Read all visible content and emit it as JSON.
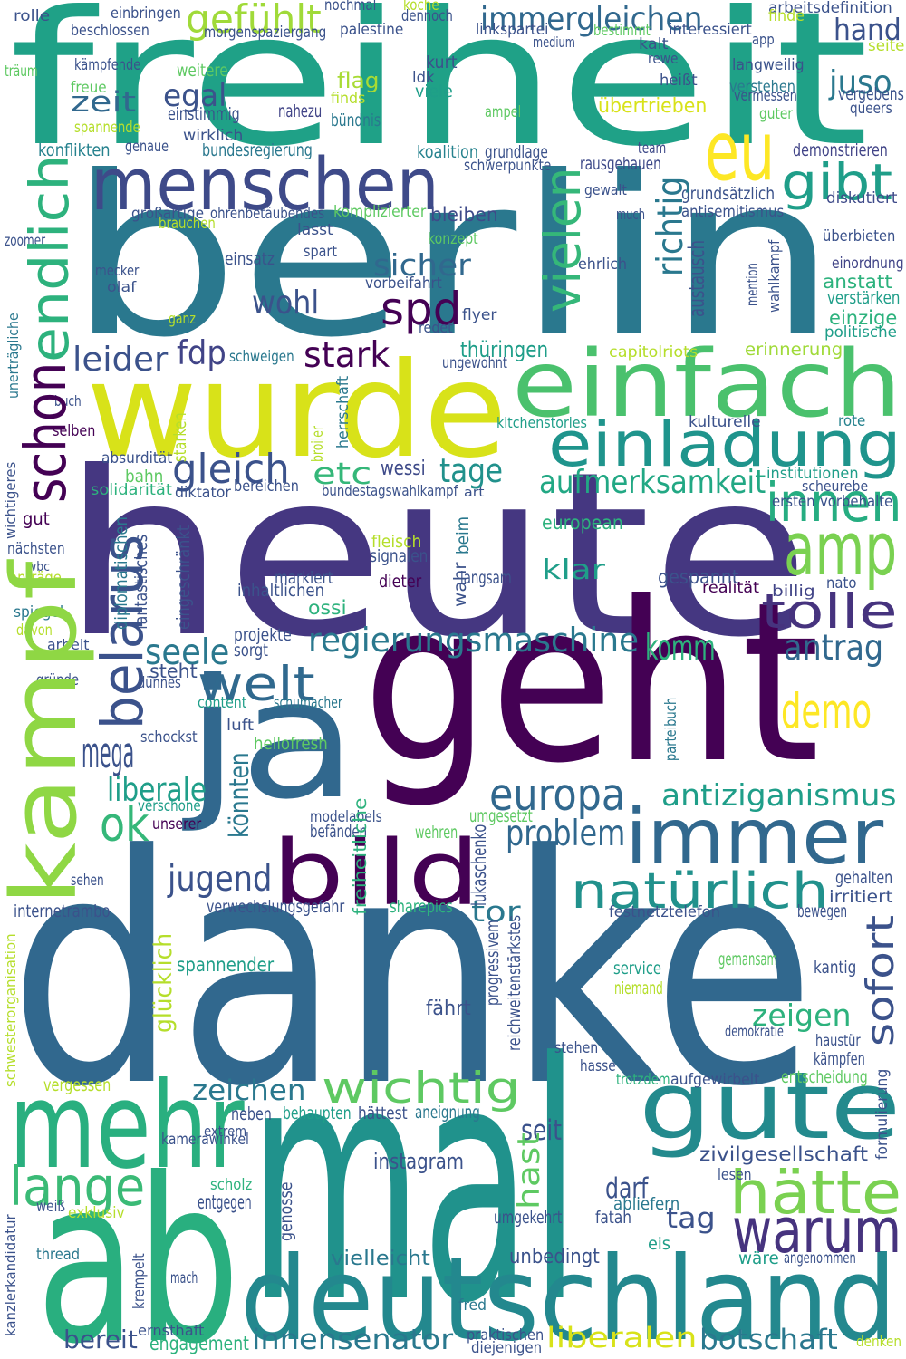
{
  "words": [
    {
      "text": "freiheit",
      "color": "#1fa187"
    },
    {
      "text": "berlin",
      "color": "#2a788e"
    },
    {
      "text": "wurde",
      "color": "#d8e219"
    },
    {
      "text": "einfach",
      "color": "#4ac16d"
    },
    {
      "text": "einladung",
      "color": "#1f948c"
    },
    {
      "text": "heute",
      "color": "#453781"
    },
    {
      "text": "geht",
      "color": "#440154"
    },
    {
      "text": "ja",
      "color": "#31688e"
    },
    {
      "text": "danke",
      "color": "#31688e"
    },
    {
      "text": "mal",
      "color": "#20928c"
    },
    {
      "text": "ab",
      "color": "#29af7f"
    },
    {
      "text": "deutschland",
      "color": "#23888e"
    },
    {
      "text": "gute",
      "color": "#238a8d"
    },
    {
      "text": "mehr",
      "color": "#29af7f"
    },
    {
      "text": "lange",
      "color": "#3aba76"
    },
    {
      "text": "hätte",
      "color": "#7ad151"
    },
    {
      "text": "warum",
      "color": "#46337e"
    },
    {
      "text": "amp",
      "color": "#7ad151"
    },
    {
      "text": "innen",
      "color": "#26ad81"
    },
    {
      "text": "tolle",
      "color": "#46337e"
    },
    {
      "text": "antrag",
      "color": "#31688e"
    },
    {
      "text": "demo",
      "color": "#fde725"
    },
    {
      "text": "immer",
      "color": "#31688e"
    },
    {
      "text": "bild",
      "color": "#440154"
    },
    {
      "text": "natürlich",
      "color": "#21918c"
    },
    {
      "text": "europa",
      "color": "#31688e"
    },
    {
      "text": "antiziganismus",
      "color": "#1f9e89"
    },
    {
      "text": "problem",
      "color": "#31688e"
    },
    {
      "text": "jugend",
      "color": "#3b528b"
    },
    {
      "text": "ok",
      "color": "#35b779"
    },
    {
      "text": "liberale",
      "color": "#1f9e89"
    },
    {
      "text": "mega",
      "color": "#3b528b"
    },
    {
      "text": "welt",
      "color": "#30698e"
    },
    {
      "text": "seele",
      "color": "#2a788e"
    },
    {
      "text": "regierungsmaschine",
      "color": "#2a788e"
    },
    {
      "text": "komm",
      "color": "#2db27d"
    },
    {
      "text": "gleich",
      "color": "#3b528b"
    },
    {
      "text": "etc",
      "color": "#35b779"
    },
    {
      "text": "wessi",
      "color": "#3e4a89"
    },
    {
      "text": "tage",
      "color": "#21918c"
    },
    {
      "text": "aufmerksamkeit",
      "color": "#22a884"
    },
    {
      "text": "stark",
      "color": "#440154"
    },
    {
      "text": "leider",
      "color": "#3b528b"
    },
    {
      "text": "fdp",
      "color": "#414487"
    },
    {
      "text": "thüringen",
      "color": "#1f9e89"
    },
    {
      "text": "spd",
      "color": "#440154"
    },
    {
      "text": "wohl",
      "color": "#3b528b"
    },
    {
      "text": "sicher",
      "color": "#31688e"
    },
    {
      "text": "menschen",
      "color": "#3e4a89"
    },
    {
      "text": "eu",
      "color": "#fde725"
    },
    {
      "text": "gibt",
      "color": "#1f9e89"
    },
    {
      "text": "immergleichen",
      "color": "#31688e"
    },
    {
      "text": "gefühlt",
      "color": "#a0da39"
    },
    {
      "text": "egal",
      "color": "#3b528b"
    },
    {
      "text": "zeit",
      "color": "#31688e"
    },
    {
      "text": "hand",
      "color": "#3b528b"
    },
    {
      "text": "juso",
      "color": "#2a788e"
    },
    {
      "text": "übertrieben",
      "color": "#d8e219"
    },
    {
      "text": "flag",
      "color": "#a8db34"
    },
    {
      "text": "viele",
      "color": "#1f9e89"
    },
    {
      "text": "kurt",
      "color": "#3b528b"
    },
    {
      "text": "ldk",
      "color": "#3b528b"
    },
    {
      "text": "nahezu",
      "color": "#414487"
    },
    {
      "text": "bündnis",
      "color": "#2a788e"
    },
    {
      "text": "konflikten",
      "color": "#26828e"
    },
    {
      "text": "bundesregierung",
      "color": "#2a788e"
    },
    {
      "text": "team",
      "color": "#3e4a89"
    },
    {
      "text": "demonstrieren",
      "color": "#414487"
    },
    {
      "text": "grundlage",
      "color": "#3b528b"
    },
    {
      "text": "koalition",
      "color": "#26828e"
    },
    {
      "text": "rausgehauen",
      "color": "#3e4a89"
    },
    {
      "text": "schwerpunkte",
      "color": "#3b528b"
    },
    {
      "text": "grundsätzlich",
      "color": "#3b528b"
    },
    {
      "text": "antisemitismus",
      "color": "#3b528b"
    },
    {
      "text": "bleiben",
      "color": "#3e4a89"
    },
    {
      "text": "komplizierter",
      "color": "#5ec962"
    },
    {
      "text": "ohrenbetäubendes",
      "color": "#3b528b"
    },
    {
      "text": "diskutiert",
      "color": "#3e4a89"
    },
    {
      "text": "überbieten",
      "color": "#3b528b"
    },
    {
      "text": "einordnung",
      "color": "#414487"
    },
    {
      "text": "anstatt",
      "color": "#2db27d"
    },
    {
      "text": "verstärken",
      "color": "#1f9e89"
    },
    {
      "text": "einzige",
      "color": "#2db27d"
    },
    {
      "text": "politische",
      "color": "#1f9e89"
    },
    {
      "text": "erinnerung",
      "color": "#a0da39"
    },
    {
      "text": "capitolriots",
      "color": "#b5de2b"
    },
    {
      "text": "ungewohnt",
      "color": "#3b528b"
    },
    {
      "text": "kitchenstories",
      "color": "#1f9e89"
    },
    {
      "text": "kulturelle",
      "color": "#3b528b"
    },
    {
      "text": "rote",
      "color": "#26828e"
    },
    {
      "text": "institutionen",
      "color": "#1f9e89"
    },
    {
      "text": "scheurebe",
      "color": "#3b528b"
    },
    {
      "text": "ersten",
      "color": "#3b528b"
    },
    {
      "text": "vorbehalte",
      "color": "#3b528b"
    },
    {
      "text": "nato",
      "color": "#3b528b"
    },
    {
      "text": "billig",
      "color": "#414487"
    },
    {
      "text": "realität",
      "color": "#440154"
    },
    {
      "text": "gespannt",
      "color": "#3b528b"
    },
    {
      "text": "klar",
      "color": "#1f9e89"
    },
    {
      "text": "european",
      "color": "#2db27d"
    },
    {
      "text": "signalen",
      "color": "#3b528b"
    },
    {
      "text": "fleisch",
      "color": "#b5de2b"
    },
    {
      "text": "dieter",
      "color": "#440154"
    },
    {
      "text": "langsam",
      "color": "#3b528b"
    },
    {
      "text": "inhaltlichen",
      "color": "#3b528b"
    },
    {
      "text": "markiert",
      "color": "#3b528b"
    },
    {
      "text": "ossi",
      "color": "#2db27d"
    },
    {
      "text": "projekte",
      "color": "#3b528b"
    },
    {
      "text": "sorgt",
      "color": "#3b528b"
    },
    {
      "text": "steht",
      "color": "#3b528b"
    },
    {
      "text": "dünnes",
      "color": "#3b528b"
    },
    {
      "text": "content",
      "color": "#1f9e89"
    },
    {
      "text": "schumacher",
      "color": "#2a788e"
    },
    {
      "text": "luft",
      "color": "#3b528b"
    },
    {
      "text": "schockst",
      "color": "#3b528b"
    },
    {
      "text": "hellofresh",
      "color": "#5ec962"
    },
    {
      "text": "verschone",
      "color": "#1f9e89"
    },
    {
      "text": "unserer",
      "color": "#440154"
    },
    {
      "text": "modelabels",
      "color": "#3b528b"
    },
    {
      "text": "befänden",
      "color": "#3b528b"
    },
    {
      "text": "umgesetzt",
      "color": "#5ec962"
    },
    {
      "text": "wehren",
      "color": "#5ec962"
    },
    {
      "text": "sharepics",
      "color": "#2db27d"
    },
    {
      "text": "tor",
      "color": "#2a788e"
    },
    {
      "text": "verwechslungsgefahr",
      "color": "#3b528b"
    },
    {
      "text": "internetrambo",
      "color": "#3b528b"
    },
    {
      "text": "sehen",
      "color": "#3b528b"
    },
    {
      "text": "festnetztelefon",
      "color": "#3b528b"
    },
    {
      "text": "gehalten",
      "color": "#3b528b"
    },
    {
      "text": "irritiert",
      "color": "#3b528b"
    },
    {
      "text": "bewegen",
      "color": "#3b528b"
    },
    {
      "text": "spannender",
      "color": "#1f9e89"
    },
    {
      "text": "gemansam",
      "color": "#5ec962"
    },
    {
      "text": "service",
      "color": "#1f9e89"
    },
    {
      "text": "kantig",
      "color": "#3b528b"
    },
    {
      "text": "niemand",
      "color": "#b5de2b"
    },
    {
      "text": "fährt",
      "color": "#3b528b"
    },
    {
      "text": "zeigen",
      "color": "#2db27d"
    },
    {
      "text": "demokratie",
      "color": "#3b528b"
    },
    {
      "text": "haustür",
      "color": "#3b528b"
    },
    {
      "text": "kämpfen",
      "color": "#3b528b"
    },
    {
      "text": "stehen",
      "color": "#3b528b"
    },
    {
      "text": "hasse",
      "color": "#3b528b"
    },
    {
      "text": "trotzdem",
      "color": "#2db27d"
    },
    {
      "text": "aufgewirbelt",
      "color": "#3b528b"
    },
    {
      "text": "entscheidung",
      "color": "#5ec962"
    },
    {
      "text": "wichtig",
      "color": "#5ec962"
    },
    {
      "text": "zeichen",
      "color": "#2a788e"
    },
    {
      "text": "neben",
      "color": "#3b528b"
    },
    {
      "text": "behaupten",
      "color": "#1f9e89"
    },
    {
      "text": "hättest",
      "color": "#3b528b"
    },
    {
      "text": "aneignung",
      "color": "#2a788e"
    },
    {
      "text": "seit",
      "color": "#3b528b"
    },
    {
      "text": "zivilgesellschaft",
      "color": "#3b528b"
    },
    {
      "text": "instagram",
      "color": "#3b528b"
    },
    {
      "text": "darf",
      "color": "#3b528b"
    },
    {
      "text": "lesen",
      "color": "#3b528b"
    },
    {
      "text": "abliefern",
      "color": "#2a788e"
    },
    {
      "text": "tag",
      "color": "#3b528b"
    },
    {
      "text": "fatah",
      "color": "#3b528b"
    },
    {
      "text": "umgekehrt",
      "color": "#3b528b"
    },
    {
      "text": "vielleicht",
      "color": "#2a788e"
    },
    {
      "text": "unbedingt",
      "color": "#3b528b"
    },
    {
      "text": "eis",
      "color": "#1f9e89"
    },
    {
      "text": "wäre",
      "color": "#1f9e89"
    },
    {
      "text": "angenommen",
      "color": "#3b528b"
    },
    {
      "text": "entgegen",
      "color": "#3b528b"
    },
    {
      "text": "scholz",
      "color": "#2db27d"
    },
    {
      "text": "kamerawinkel",
      "color": "#3b528b"
    },
    {
      "text": "extrem",
      "color": "#3b528b"
    },
    {
      "text": "vergessen",
      "color": "#b5de2b"
    },
    {
      "text": "exklusiv",
      "color": "#b5de2b"
    },
    {
      "text": "weiß",
      "color": "#3b528b"
    },
    {
      "text": "thread",
      "color": "#2a788e"
    },
    {
      "text": "mach",
      "color": "#3b528b"
    },
    {
      "text": "bereit",
      "color": "#3b528b"
    },
    {
      "text": "ernsthaft",
      "color": "#3b528b"
    },
    {
      "text": "engagement",
      "color": "#2db27d"
    },
    {
      "text": "innensenator",
      "color": "#2a788e"
    },
    {
      "text": "praktischen",
      "color": "#3b528b"
    },
    {
      "text": "diejenigen",
      "color": "#3b528b"
    },
    {
      "text": "liberalen",
      "color": "#d8e219"
    },
    {
      "text": "botschaft",
      "color": "#2a788e"
    },
    {
      "text": "denken",
      "color": "#b5de2b"
    },
    {
      "text": "fred",
      "color": "#2a788e"
    },
    {
      "text": "arbeit",
      "color": "#3b528b"
    },
    {
      "text": "gründe",
      "color": "#3b528b"
    },
    {
      "text": "bahn",
      "color": "#5ec962"
    },
    {
      "text": "solidarität",
      "color": "#2db27d"
    },
    {
      "text": "absurdität",
      "color": "#3b528b"
    },
    {
      "text": "diktator",
      "color": "#3b528b"
    },
    {
      "text": "bereichen",
      "color": "#3b528b"
    },
    {
      "text": "bundestagswahlkampf",
      "color": "#3b528b"
    },
    {
      "text": "art",
      "color": "#3b528b"
    },
    {
      "text": "gut",
      "color": "#440154"
    },
    {
      "text": "nächsten",
      "color": "#3b528b"
    },
    {
      "text": "wbc",
      "color": "#3b528b"
    },
    {
      "text": "anträge",
      "color": "#b5de2b"
    },
    {
      "text": "spiegel",
      "color": "#2a788e"
    },
    {
      "text": "davon",
      "color": "#b5de2b"
    },
    {
      "text": "buch",
      "color": "#3b528b"
    },
    {
      "text": "selben",
      "color": "#440154"
    },
    {
      "text": "mecker",
      "color": "#3b528b"
    },
    {
      "text": "olaf",
      "color": "#3b528b"
    },
    {
      "text": "einsatz",
      "color": "#3b528b"
    },
    {
      "text": "lasst",
      "color": "#3b528b"
    },
    {
      "text": "spart",
      "color": "#3b528b"
    },
    {
      "text": "großartige",
      "color": "#3b528b"
    },
    {
      "text": "brauchen",
      "color": "#b5de2b"
    },
    {
      "text": "zoomer",
      "color": "#3b528b"
    },
    {
      "text": "ganz",
      "color": "#b5de2b"
    },
    {
      "text": "schweigen",
      "color": "#2a788e"
    },
    {
      "text": "redet",
      "color": "#3b528b"
    },
    {
      "text": "flyer",
      "color": "#3b528b"
    },
    {
      "text": "vorbeifahrt",
      "color": "#3b528b"
    },
    {
      "text": "konzept",
      "color": "#5ec962"
    },
    {
      "text": "gewalt",
      "color": "#3b528b"
    },
    {
      "text": "much",
      "color": "#3b528b"
    },
    {
      "text": "ehrlich",
      "color": "#3b528b"
    },
    {
      "text": "rolle",
      "color": "#3b528b"
    },
    {
      "text": "beschlossen",
      "color": "#3b528b"
    },
    {
      "text": "kämpfende",
      "color": "#3b528b"
    },
    {
      "text": "freue",
      "color": "#5ec962"
    },
    {
      "text": "einstimmig",
      "color": "#3b528b"
    },
    {
      "text": "wirklich",
      "color": "#3b528b"
    },
    {
      "text": "spannende",
      "color": "#b5de2b"
    },
    {
      "text": "genaue",
      "color": "#3b528b"
    },
    {
      "text": "weitere",
      "color": "#5ec962"
    },
    {
      "text": "morgenspaziergang",
      "color": "#3b528b"
    },
    {
      "text": "nochmal",
      "color": "#3b528b"
    },
    {
      "text": "einbringen",
      "color": "#3b528b"
    },
    {
      "text": "palestine",
      "color": "#3b528b"
    },
    {
      "text": "koche",
      "color": "#b5de2b"
    },
    {
      "text": "dennoch",
      "color": "#3b528b"
    },
    {
      "text": "linkspartei",
      "color": "#3b528b"
    },
    {
      "text": "medium",
      "color": "#3b528b"
    },
    {
      "text": "bestimmt",
      "color": "#5ec962"
    },
    {
      "text": "interessiert",
      "color": "#3b528b"
    },
    {
      "text": "arbeitsdefinition",
      "color": "#3b528b"
    },
    {
      "text": "finde",
      "color": "#b5de2b"
    },
    {
      "text": "kalt",
      "color": "#3b528b"
    },
    {
      "text": "rewe",
      "color": "#3b528b"
    },
    {
      "text": "app",
      "color": "#3b528b"
    },
    {
      "text": "seite",
      "color": "#b5de2b"
    },
    {
      "text": "langweilig",
      "color": "#3b528b"
    },
    {
      "text": "heißt",
      "color": "#3b528b"
    },
    {
      "text": "verstehen",
      "color": "#2a788e"
    },
    {
      "text": "vermessen",
      "color": "#3b528b"
    },
    {
      "text": "vergebens",
      "color": "#3b528b"
    },
    {
      "text": "queers",
      "color": "#3b528b"
    },
    {
      "text": "guter",
      "color": "#5ec962"
    },
    {
      "text": "ampel",
      "color": "#5ec962"
    },
    {
      "text": "träum",
      "color": "#5ec962"
    },
    {
      "text": "finds",
      "color": "#b5de2b"
    },
    {
      "text": "kampf",
      "color": "#8fd744"
    },
    {
      "text": "endlich",
      "color": "#2db27d"
    },
    {
      "text": "schon",
      "color": "#440154"
    },
    {
      "text": "belarus",
      "color": "#3b528b"
    },
    {
      "text": "vielen",
      "color": "#35b779"
    },
    {
      "text": "richtig",
      "color": "#2a788e"
    },
    {
      "text": "könnten",
      "color": "#2a788e"
    },
    {
      "text": "glücklich",
      "color": "#b5de2b"
    },
    {
      "text": "sofort",
      "color": "#3b528b"
    },
    {
      "text": "lukaschenko",
      "color": "#3b528b"
    },
    {
      "text": "reichweitenstärkstes",
      "color": "#3b528b"
    },
    {
      "text": "freiheitliche",
      "color": "#2db27d"
    },
    {
      "text": "progressivem",
      "color": "#3b528b"
    },
    {
      "text": "hast",
      "color": "#5ec962"
    },
    {
      "text": "genosse",
      "color": "#3b528b"
    },
    {
      "text": "krempelt",
      "color": "#3b528b"
    },
    {
      "text": "formulierung",
      "color": "#3b528b"
    },
    {
      "text": "eingeschränkt",
      "color": "#3b528b"
    },
    {
      "text": "fantastisches",
      "color": "#3b528b"
    },
    {
      "text": "diplomatischen",
      "color": "#2a788e"
    },
    {
      "text": "beim",
      "color": "#2a788e"
    },
    {
      "text": "wahr",
      "color": "#3b528b"
    },
    {
      "text": "austausch",
      "color": "#3b528b"
    },
    {
      "text": "mention",
      "color": "#3b528b"
    },
    {
      "text": "wahlkampf",
      "color": "#3b528b"
    },
    {
      "text": "parteibuch",
      "color": "#2a788e"
    },
    {
      "text": "schwesterorganisation",
      "color": "#b5de2b"
    },
    {
      "text": "kanzlerkandidatur",
      "color": "#3b528b"
    },
    {
      "text": "herrschaft",
      "color": "#2a788e"
    },
    {
      "text": "starken",
      "color": "#b5de2b"
    },
    {
      "text": "broiler",
      "color": "#b5de2b"
    },
    {
      "text": "wichtigeres",
      "color": "#3b528b"
    },
    {
      "text": "unerträgliche",
      "color": "#2a788e"
    }
  ]
}
